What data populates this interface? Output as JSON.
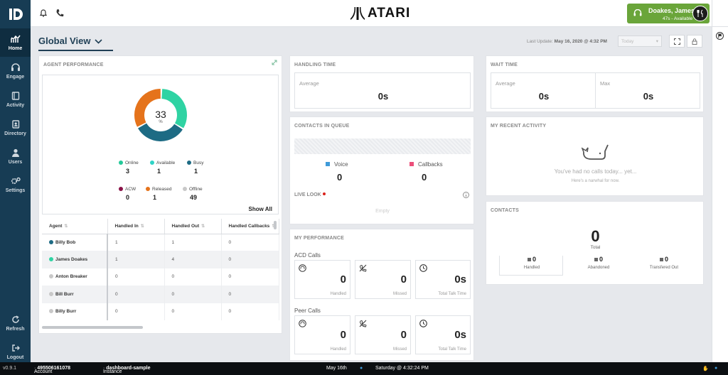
{
  "nav": {
    "items": [
      {
        "label": "Home"
      },
      {
        "label": "Engage"
      },
      {
        "label": "Activity"
      },
      {
        "label": "Directory"
      },
      {
        "label": "Users"
      },
      {
        "label": "Settings"
      }
    ],
    "refresh": "Refresh",
    "logout": "Logout",
    "version": "v0.9.1"
  },
  "header": {
    "brand": "ATARI",
    "agent_name": "Doakes, James",
    "agent_state": "47s - Available"
  },
  "view": {
    "title": "Global View",
    "last_update_label": "Last Update:",
    "last_update_value": "May 16, 2020 @ 4:32 PM",
    "period": "Today"
  },
  "agent_performance": {
    "title": "AGENT PERFORMANCE",
    "total": "33",
    "total_unit": "%",
    "legend": [
      {
        "label": "Online",
        "count": "3",
        "color": "#24c99a"
      },
      {
        "label": "Available",
        "count": "1",
        "color": "#2fd3c6"
      },
      {
        "label": "Busy",
        "count": "1",
        "color": "#1d6b84"
      },
      {
        "label": "ACW",
        "count": "0",
        "color": "#8a1247"
      },
      {
        "label": "Released",
        "count": "1",
        "color": "#e5731b"
      },
      {
        "label": "Offline",
        "count": "49",
        "color": "#c8c8c8"
      }
    ],
    "donut_segments": [
      {
        "name": "Available",
        "fraction": 0.333,
        "color": "#2fd3a3"
      },
      {
        "name": "Busy",
        "fraction": 0.333,
        "color": "#1d6b84"
      },
      {
        "name": "Released",
        "fraction": 0.333,
        "color": "#e5731b"
      }
    ],
    "show_all": "Show All",
    "columns": [
      "Agent",
      "Handled In",
      "Handled Out",
      "Handled Callbacks"
    ],
    "rows": [
      {
        "name": "Billy Bob",
        "status_color": "#1d6b84",
        "handled_in": "1",
        "handled_out": "1",
        "callbacks": "0"
      },
      {
        "name": "James Doakes",
        "status_color": "#2fd3a3",
        "handled_in": "1",
        "handled_out": "4",
        "callbacks": "0"
      },
      {
        "name": "Anton Breaker",
        "status_color": "#c8c8c8",
        "handled_in": "0",
        "handled_out": "0",
        "callbacks": "0"
      },
      {
        "name": "Bill Burr",
        "status_color": "#c8c8c8",
        "handled_in": "0",
        "handled_out": "0",
        "callbacks": "0"
      },
      {
        "name": "Billy Burr",
        "status_color": "#c8c8c8",
        "handled_in": "0",
        "handled_out": "0",
        "callbacks": "0"
      }
    ]
  },
  "handling_time": {
    "title": "HANDLING TIME",
    "average_label": "Average",
    "average_value": "0s"
  },
  "contacts_in_queue": {
    "title": "CONTACTS IN QUEUE",
    "voice_label": "Voice",
    "voice_value": "0",
    "voice_color": "#3f9bd9",
    "callbacks_label": "Callbacks",
    "callbacks_value": "0",
    "callbacks_color": "#ec4f7a",
    "live_look_label": "LIVE LOOK",
    "empty_text": "Empty"
  },
  "my_performance": {
    "title": "MY PERFORMANCE",
    "acd": {
      "label": "ACD Calls",
      "handled": "0",
      "handled_label": "Handled",
      "missed": "0",
      "missed_label": "Missed",
      "talk": "0s",
      "talk_label": "Total Talk Time"
    },
    "peer": {
      "label": "Peer Calls",
      "handled": "0",
      "handled_label": "Handled",
      "missed": "0",
      "missed_label": "Missed",
      "talk": "0s",
      "talk_label": "Total Talk Time"
    }
  },
  "wait_time": {
    "title": "WAIT TIME",
    "average_label": "Average",
    "average_value": "0s",
    "max_label": "Max",
    "max_value": "0s"
  },
  "recent_activity": {
    "title": "MY RECENT ACTIVITY",
    "message": "You've had no calls today... yet...",
    "submessage": "Here's a narwhal for now."
  },
  "contacts": {
    "title": "CONTACTS",
    "total_value": "0",
    "total_label": "Total",
    "handled_value": "0",
    "handled_label": "Handled",
    "abandoned_value": "0",
    "abandoned_label": "Abandoned",
    "transferred_value": "0",
    "transferred_label": "Transfered Out"
  },
  "statusbar": {
    "account_label": "Account",
    "account_value": "495506161078",
    "instance_label": "Instance",
    "instance_value": "dashboard-sample",
    "date": "May 16th",
    "datetime": "Saturday @ 4:32:24 PM"
  }
}
